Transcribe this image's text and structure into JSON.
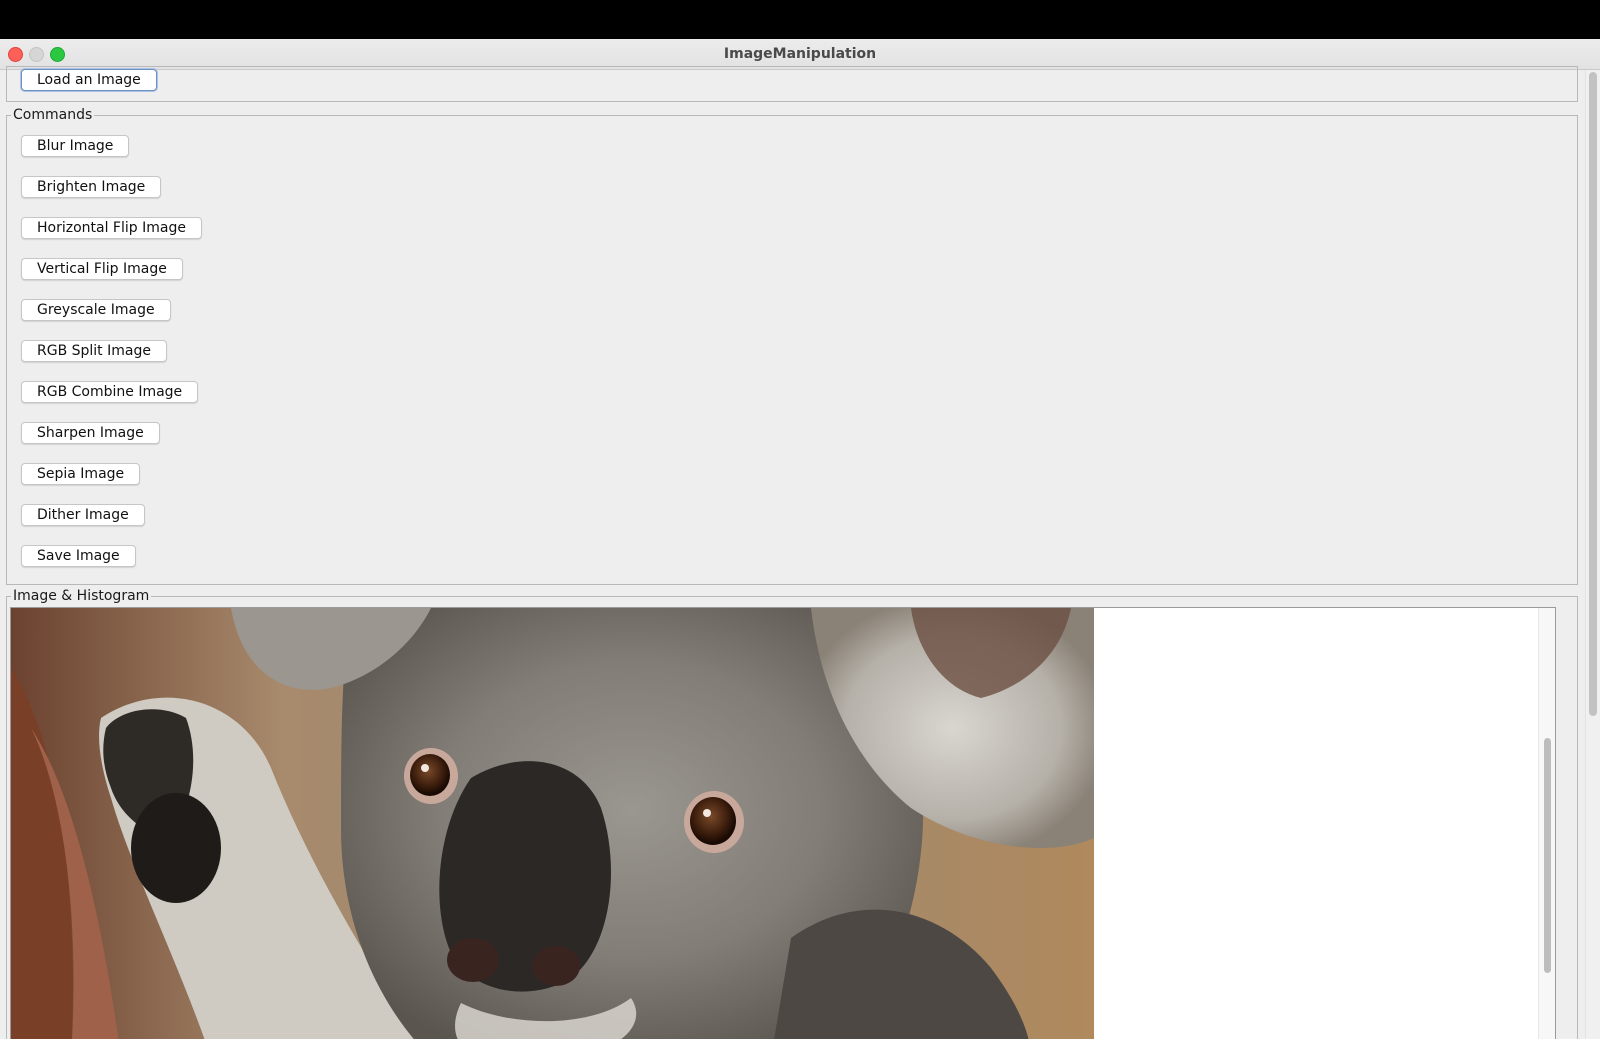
{
  "window": {
    "title": "ImageManipulation"
  },
  "load_panel": {
    "load_button": "Load an Image"
  },
  "commands_panel": {
    "legend": "Commands",
    "buttons": [
      "Blur Image",
      "Brighten Image",
      "Horizontal Flip Image",
      "Vertical Flip Image",
      "Greyscale Image",
      "RGB Split Image",
      "RGB Combine Image",
      "Sharpen Image",
      "Sepia Image",
      "Dither Image",
      "Save Image"
    ]
  },
  "image_panel": {
    "legend": "Image & Histogram",
    "image_subject": "koala-photo"
  },
  "colors": {
    "window_bg": "#eeeeee",
    "close": "#fe5f57",
    "minimize": "#d6d6d6",
    "maximize": "#29c840",
    "focus_ring": "#6f90c2"
  }
}
